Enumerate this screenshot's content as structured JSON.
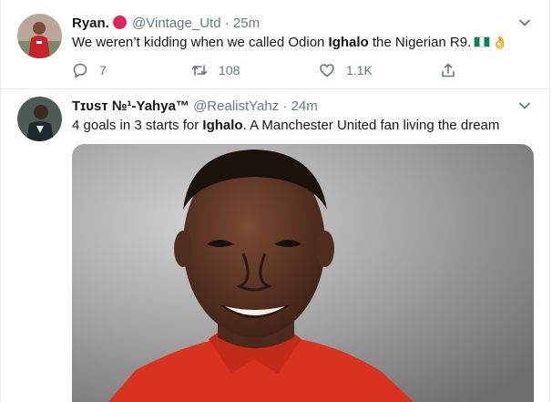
{
  "tweets": [
    {
      "name": "Ryan.",
      "handle": "@Vintage_Utd",
      "separator": "·",
      "time": "25m",
      "text_before": "We weren’t kidding when we called Odion ",
      "text_highlight": "Ighalo",
      "text_after": " the Nigerian R9.",
      "emoji": [
        "nigeria-flag",
        "ok-hand"
      ],
      "replies": "7",
      "retweets": "108",
      "likes": "1.1K"
    },
    {
      "name": "Tɪᴜsᴛ №¹-Yahya™",
      "handle": "@RealistYahz",
      "separator": "·",
      "time": "24m",
      "text_before": "4 goals in 3 starts for ",
      "text_highlight": "Ighalo",
      "text_after": ". A Manchester United fan living the dream",
      "media": "photo"
    }
  ],
  "colors": {
    "accent": "#1da1f2",
    "muted": "#657786",
    "badge": "#e0245e",
    "shirt": "#d9331f"
  }
}
